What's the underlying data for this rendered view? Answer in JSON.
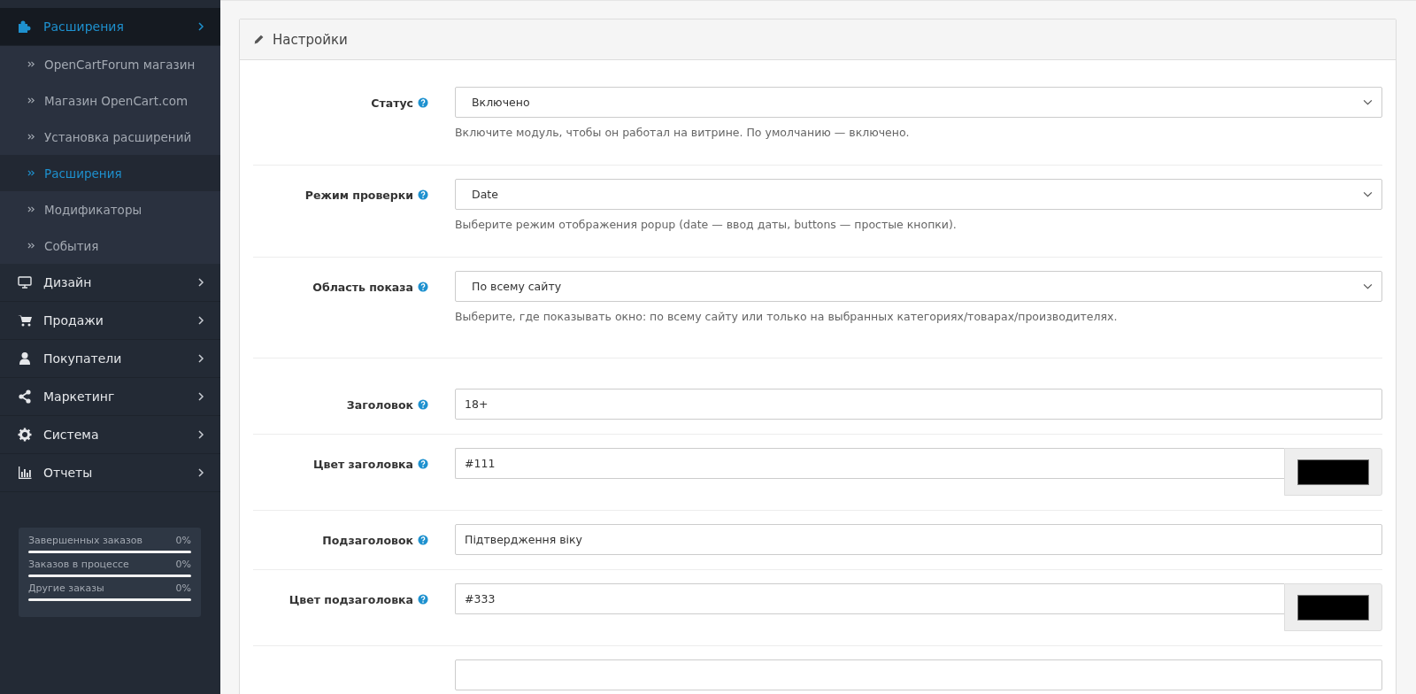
{
  "sidebar": {
    "items": [
      {
        "label": "Расширения",
        "selected": true,
        "children": [
          {
            "label": "OpenCartForum магазин",
            "selected": false
          },
          {
            "label": "Магазин OpenCart.com",
            "selected": false
          },
          {
            "label": "Установка расширений",
            "selected": false
          },
          {
            "label": "Расширения",
            "selected": true
          },
          {
            "label": "Модификаторы",
            "selected": false
          },
          {
            "label": "События",
            "selected": false
          }
        ]
      },
      {
        "label": "Дизайн",
        "selected": false
      },
      {
        "label": "Продажи",
        "selected": false
      },
      {
        "label": "Покупатели",
        "selected": false
      },
      {
        "label": "Маркетинг",
        "selected": false
      },
      {
        "label": "Система",
        "selected": false
      },
      {
        "label": "Отчеты",
        "selected": false
      }
    ],
    "stats": [
      {
        "label": "Завершенных заказов",
        "reading": "0%",
        "level": 0
      },
      {
        "label": "Заказов в процессе",
        "reading": "0%",
        "level": 0
      },
      {
        "label": "Другие заказы",
        "reading": "0%",
        "level": 0
      }
    ]
  },
  "panel": {
    "title": "Настройки",
    "fields": [
      {
        "kind": "select",
        "label": "Статус",
        "value": "Включено",
        "help": "Включите модуль, чтобы он работал на витрине. По умолчанию — включено."
      },
      {
        "kind": "select",
        "label": "Режим проверки",
        "value": "Date",
        "help": "Выберите режим отображения popup (date — ввод даты, buttons — простые кнопки)."
      },
      {
        "kind": "select",
        "label": "Область показа",
        "value": "По всему сайту",
        "help": "Выберите, где показывать окно: по всему сайту или только на выбранных категориях/товарах/производителях."
      },
      {
        "kind": "divider"
      },
      {
        "kind": "text",
        "label": "Заголовок",
        "value": "18+"
      },
      {
        "kind": "color",
        "label": "Цвет заголовка",
        "value": "#111",
        "color": "#000000"
      },
      {
        "kind": "text",
        "label": "Подзаголовок",
        "value": "Підтвердження віку"
      },
      {
        "kind": "color",
        "label": "Цвет подзаголовка",
        "value": "#333",
        "color": "#000000"
      },
      {
        "kind": "text"
      }
    ]
  }
}
